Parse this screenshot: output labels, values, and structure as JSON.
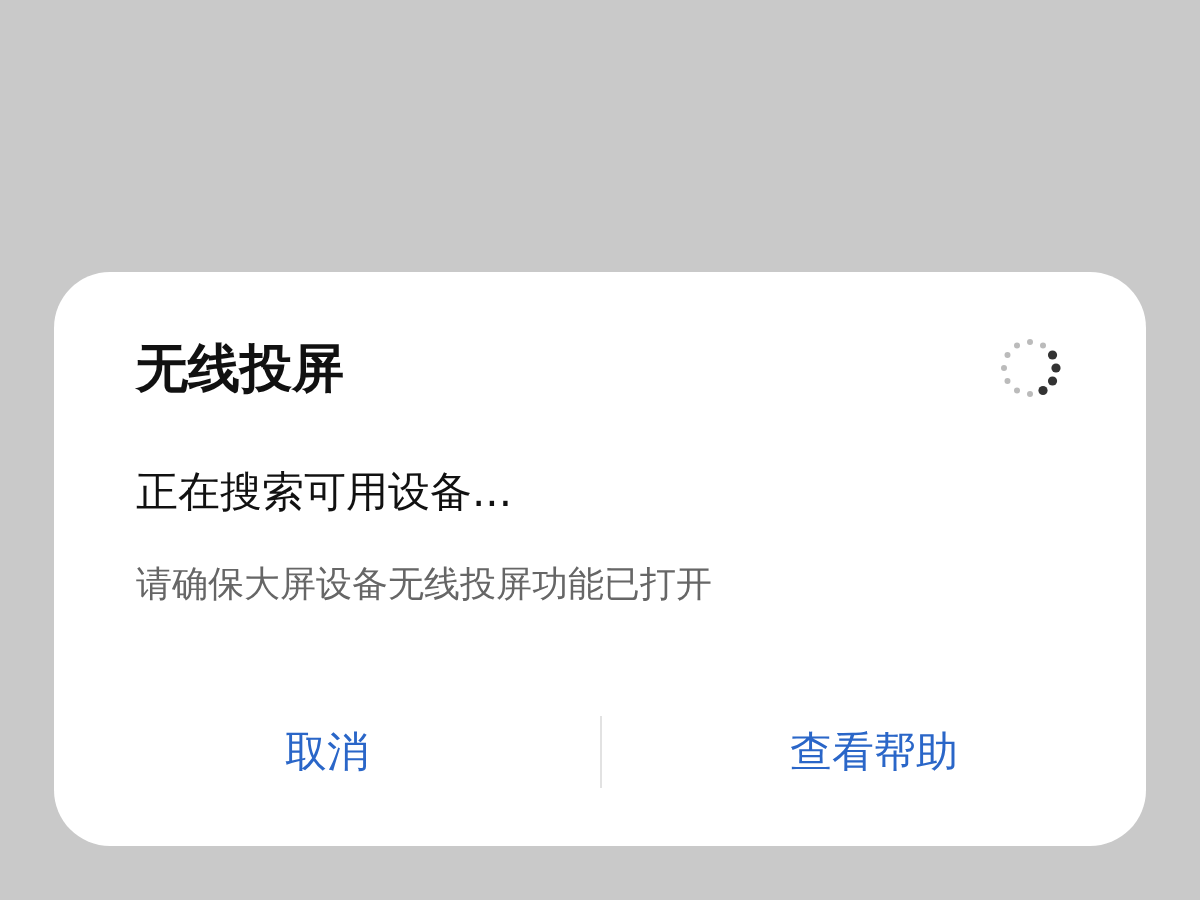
{
  "dialog": {
    "title": "无线投屏",
    "status": "正在搜索可用设备...",
    "hint": "请确保大屏设备无线投屏功能已打开",
    "buttons": [
      {
        "label": "取消"
      },
      {
        "label": "查看帮助"
      }
    ]
  }
}
